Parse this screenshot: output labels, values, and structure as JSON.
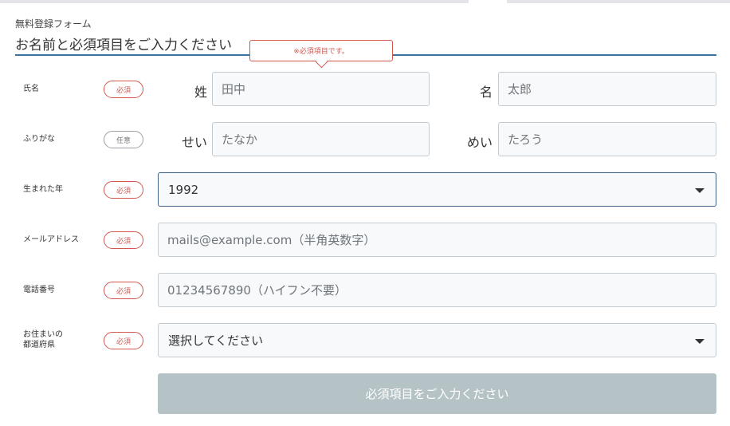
{
  "header": {
    "form_label": "無料登録フォーム",
    "headline": "お名前と必須項目をご入力ください"
  },
  "tooltip": {
    "text": "※必須項目です。"
  },
  "badges": {
    "required": "必須",
    "optional": "任意"
  },
  "rows": {
    "name": {
      "label": "氏名",
      "last_label": "姓",
      "last_placeholder": "田中",
      "first_label": "名",
      "first_placeholder": "太郎"
    },
    "furigana": {
      "label": "ふりがな",
      "last_label": "せい",
      "last_placeholder": "たなか",
      "first_label": "めい",
      "first_placeholder": "たろう"
    },
    "birth_year": {
      "label": "生まれた年",
      "selected": "1992"
    },
    "email": {
      "label": "メールアドレス",
      "placeholder": "mails@example.com（半角英数字）"
    },
    "phone": {
      "label": "電話番号",
      "placeholder": "01234567890（ハイフン不要）"
    },
    "prefecture": {
      "label_line1": "お住まいの",
      "label_line2": "都道府県",
      "selected": "選択してください"
    }
  },
  "submit": {
    "label": "必須項目をご入力ください"
  },
  "colors": {
    "required": "#d2574f",
    "accent": "#3b73a0",
    "submit_disabled": "#b5c3c7"
  }
}
